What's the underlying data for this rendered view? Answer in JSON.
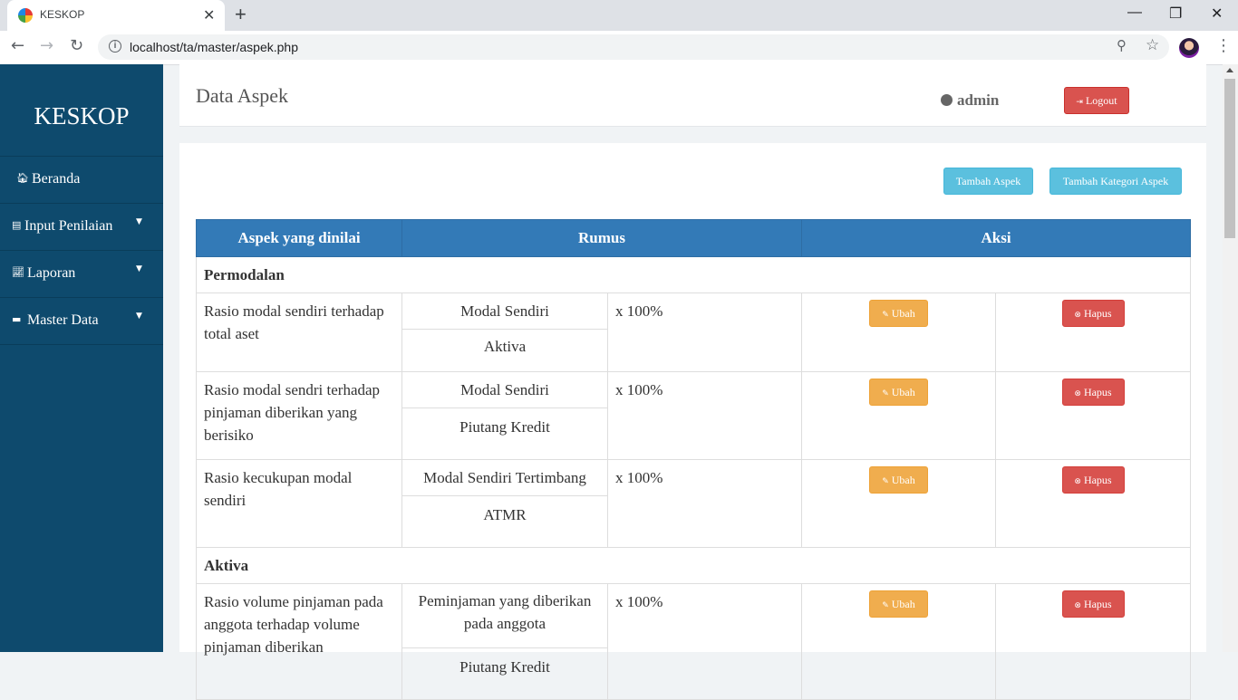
{
  "browser": {
    "tab_title": "KESKOP",
    "url": "localhost/ta/master/aspek.php"
  },
  "sidebar": {
    "brand": "KESKOP",
    "items": [
      {
        "label": "Beranda",
        "icon": "home-icon"
      },
      {
        "label": "Input Penilaian",
        "icon": "file-icon",
        "dropdown": true
      },
      {
        "label": "Laporan",
        "icon": "chart-icon",
        "dropdown": true
      },
      {
        "label": "Master Data",
        "icon": "folder-icon",
        "dropdown": true
      }
    ]
  },
  "header": {
    "title": "Data Aspek",
    "user": "admin",
    "logout_label": "Logout"
  },
  "toolbar": {
    "tambah_aspek": "Tambah Aspek",
    "tambah_kategori": "Tambah Kategori Aspek"
  },
  "table": {
    "headers": [
      "Aspek yang dinilai",
      "Rumus",
      "Aksi"
    ],
    "edit_label": "Ubah",
    "delete_label": "Hapus",
    "categories": [
      {
        "name": "Permodalan",
        "rows": [
          {
            "aspek": "Rasio modal sendiri terhadap total aset",
            "numerator": "Modal Sendiri",
            "denominator": "Aktiva",
            "multiplier": "x 100%"
          },
          {
            "aspek": "Rasio modal sendri terhadap pinjaman diberikan yang berisiko",
            "numerator": "Modal Sendiri",
            "denominator": "Piutang Kredit",
            "multiplier": "x 100%"
          },
          {
            "aspek": "Rasio kecukupan modal sendiri",
            "numerator": "Modal Sendiri Tertimbang",
            "denominator": "ATMR",
            "multiplier": "x 100%"
          }
        ]
      },
      {
        "name": "Aktiva",
        "rows": [
          {
            "aspek": "Rasio volume pinjaman pada anggota terhadap volume pinjaman diberikan",
            "numerator": "Peminjaman yang diberikan pada anggota",
            "denominator": "Piutang Kredit",
            "multiplier": "x 100%"
          }
        ]
      }
    ]
  },
  "colors": {
    "sidebar": "#0e4a6d",
    "table_header": "#337ab7",
    "btn_info": "#5bc0de",
    "btn_warning": "#f0ad4e",
    "btn_danger": "#d9534f"
  }
}
